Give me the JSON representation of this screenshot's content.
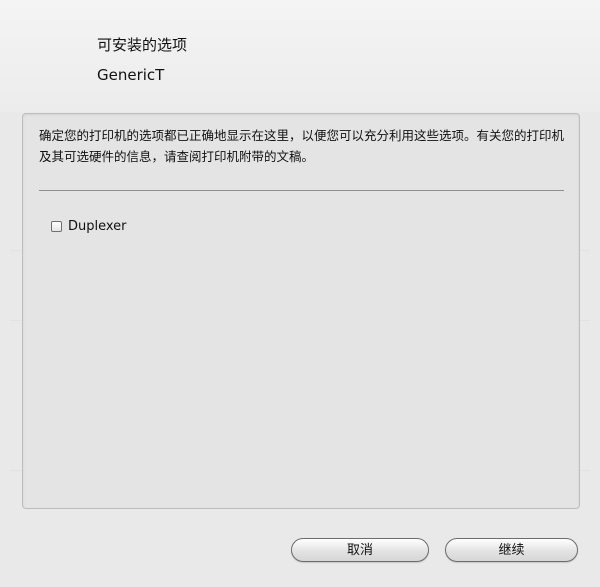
{
  "dialog": {
    "title": "可安装的选项",
    "printer_model": "GenericT",
    "description": "确定您的打印机的选项都已正确地显示在这里，以便您可以充分利用这些选项。有关您的打印机及其可选硬件的信息，请查阅打印机附带的文稿。",
    "options": [
      {
        "label": "Duplexer",
        "checked": false
      }
    ]
  },
  "buttons": {
    "cancel": "取消",
    "continue": "继续"
  }
}
